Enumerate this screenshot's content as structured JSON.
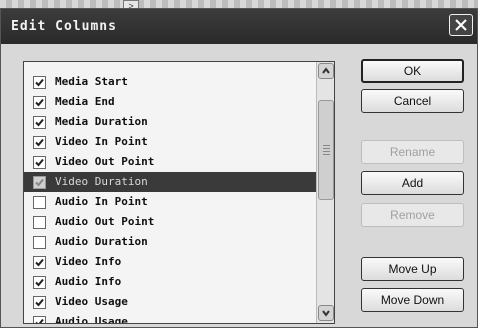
{
  "dialog": {
    "title": "Edit Columns"
  },
  "columns": [
    {
      "label": "Media Start",
      "checked": true
    },
    {
      "label": "Media End",
      "checked": true
    },
    {
      "label": "Media Duration",
      "checked": true
    },
    {
      "label": "Video In Point",
      "checked": true
    },
    {
      "label": "Video Out Point",
      "checked": true
    },
    {
      "label": "Video Duration",
      "checked": true,
      "selected": true
    },
    {
      "label": "Audio In Point",
      "checked": false
    },
    {
      "label": "Audio Out Point",
      "checked": false
    },
    {
      "label": "Audio Duration",
      "checked": false
    },
    {
      "label": "Video Info",
      "checked": true
    },
    {
      "label": "Audio Info",
      "checked": true
    },
    {
      "label": "Video Usage",
      "checked": true
    },
    {
      "label": "Audio Usage",
      "checked": true
    }
  ],
  "buttons": {
    "ok": "OK",
    "cancel": "Cancel",
    "rename": "Rename",
    "add": "Add",
    "remove": "Remove",
    "move_up": "Move Up",
    "move_down": "Move Down"
  },
  "states": {
    "rename_enabled": false,
    "remove_enabled": false
  },
  "colors": {
    "titlebar": "#2e2e2e",
    "selected_row": "#3a3a3a",
    "dialog_bg": "#d8d8d8"
  }
}
